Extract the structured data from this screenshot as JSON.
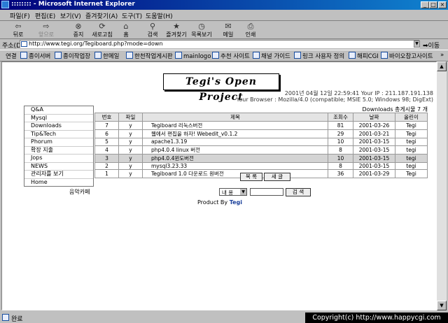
{
  "window": {
    "title": ":::::::: - Microsoft Internet Explorer"
  },
  "menu": [
    "파일(F)",
    "편집(E)",
    "보기(V)",
    "즐겨찾기(A)",
    "도구(T)",
    "도움말(H)"
  ],
  "toolbar": [
    {
      "label": "뒤로",
      "icon": "back-arrow-icon",
      "glyph": "⇦",
      "enabled": true
    },
    {
      "label": "앞으로",
      "icon": "forward-arrow-icon",
      "glyph": "⇨",
      "enabled": false
    },
    {
      "label": "중지",
      "icon": "stop-icon",
      "glyph": "⊗",
      "enabled": true
    },
    {
      "label": "새로고침",
      "icon": "refresh-icon",
      "glyph": "⟳",
      "enabled": true
    },
    {
      "label": "홈",
      "icon": "home-icon",
      "glyph": "⌂",
      "enabled": true
    },
    {
      "label": "검색",
      "icon": "search-icon",
      "glyph": "⚲",
      "enabled": true
    },
    {
      "label": "즐겨찾기",
      "icon": "favorites-icon",
      "glyph": "★",
      "enabled": true
    },
    {
      "label": "목록보기",
      "icon": "history-icon",
      "glyph": "◷",
      "enabled": true
    },
    {
      "label": "메일",
      "icon": "mail-icon",
      "glyph": "✉",
      "enabled": true
    },
    {
      "label": "인쇄",
      "icon": "print-icon",
      "glyph": "⎙",
      "enabled": true
    }
  ],
  "address": {
    "label": "주소(D)",
    "value": "http://www.tegi.org/Tegiboard.php?mode=down",
    "go": "이동"
  },
  "links": {
    "label": "연결",
    "items": [
      "종이서버",
      "종이작업장",
      "한메일",
      "한천작업게시판",
      "mainlogo",
      "추천 사이트",
      "채널 가이드",
      "링크 사용자 정의",
      "해피CGI",
      "바이오참고사이트"
    ]
  },
  "page": {
    "title": "Tegi's  Open  Project",
    "date_line": "2001년 04월 12일 22:59:41    Your IP : 211.187.191.138",
    "browser_line": "Your Browser : Mozilla/4.0 (compatible; MSIE 5.0; Windows 98; DigExt)",
    "nav": [
      "Q&A",
      "Mysql",
      "Downloads",
      "Tip&Tech",
      "Phorum",
      "확장 지출",
      "Jops",
      "NEWS",
      "관리자를 보기",
      "Home"
    ],
    "board_header": "Downloads 총게시물 7 개",
    "columns": [
      "번호",
      "파일",
      "제목",
      "조회수",
      "날짜",
      "올린이"
    ],
    "rows": [
      {
        "num": "7",
        "file": "y",
        "title": "Tegiboard 리눅스버전",
        "views": "81",
        "date": "2001-03-26",
        "author": "Tegi",
        "hl": false
      },
      {
        "num": "6",
        "file": "y",
        "title": "웹에서 편집을 하자! Webedit_v0.1.2",
        "views": "29",
        "date": "2001-03-21",
        "author": "Tegi",
        "hl": false
      },
      {
        "num": "5",
        "file": "y",
        "title": "apache1.3.19",
        "views": "10",
        "date": "2001-03-15",
        "author": "tegi",
        "hl": false
      },
      {
        "num": "4",
        "file": "y",
        "title": "php4.0.4 linux 버전",
        "views": "8",
        "date": "2001-03-15",
        "author": "tegi",
        "hl": false
      },
      {
        "num": "3",
        "file": "y",
        "title": "php4.0.4윈도버전",
        "views": "10",
        "date": "2001-03-15",
        "author": "tegi",
        "hl": true
      },
      {
        "num": "2",
        "file": "y",
        "title": "mysql3.23.33",
        "views": "8",
        "date": "2001-03-15",
        "author": "tegi",
        "hl": false
      },
      {
        "num": "1",
        "file": "y",
        "title": "Tegiboard 1.0 다운로드 원버전",
        "views": "36",
        "date": "2001-03-29",
        "author": "Tegi",
        "hl": false
      }
    ],
    "list_button": "목 록",
    "write_button": "새 글",
    "music_link": "음악카페",
    "search_option": "내 용",
    "search_button": "검 색",
    "product_prefix": "Product By ",
    "product_name": "Tegi"
  },
  "status": {
    "text": "완료",
    "copyright": "Copyright(c) http://www.happycgi.com"
  }
}
